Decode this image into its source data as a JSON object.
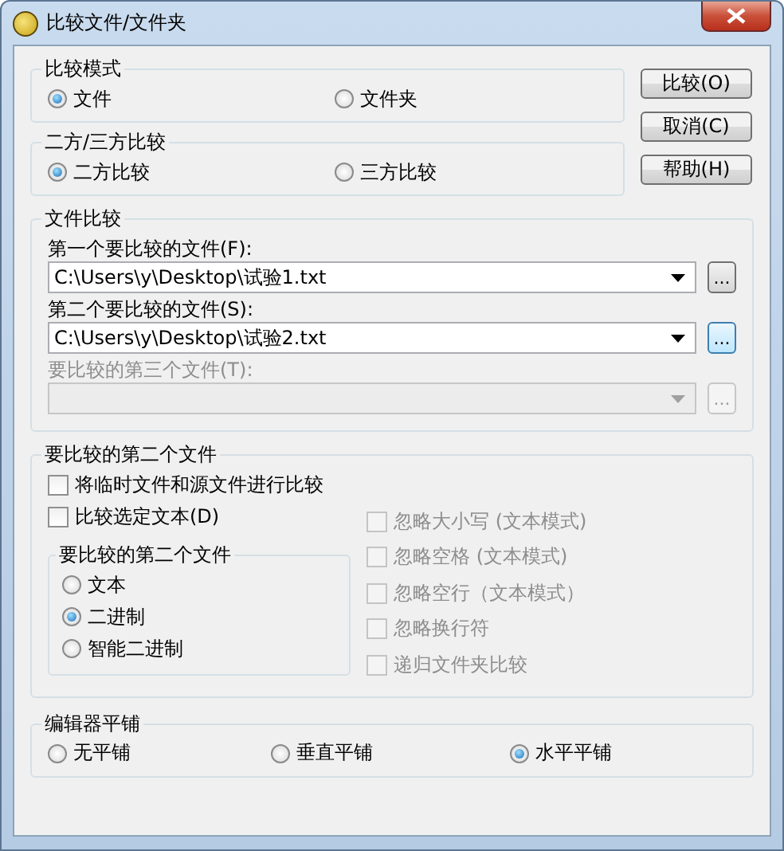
{
  "window": {
    "title": "比较文件/文件夹"
  },
  "compare_mode": {
    "label": "比较模式",
    "options": [
      {
        "label": "文件",
        "selected": true
      },
      {
        "label": "文件夹",
        "selected": false
      }
    ]
  },
  "way_mode": {
    "label": "二方/三方比较",
    "options": [
      {
        "label": "二方比较",
        "selected": true
      },
      {
        "label": "三方比较",
        "selected": false
      }
    ]
  },
  "buttons": [
    {
      "label": "比较(O)"
    },
    {
      "label": "取消(C)"
    },
    {
      "label": "帮助(H)"
    }
  ],
  "file_compare": {
    "label": "文件比较",
    "files": [
      {
        "label": "第一个要比较的文件(F):",
        "value": "C:\\Users\\y\\Desktop\\试验1.txt",
        "browse": "...",
        "disabled": false
      },
      {
        "label": "第二个要比较的文件(S):",
        "value": "C:\\Users\\y\\Desktop\\试验2.txt",
        "browse": "...",
        "disabled": false
      },
      {
        "label": "要比较的第三个文件(T):",
        "browse": "...",
        "disabled": true
      }
    ]
  },
  "second_file": {
    "label": "要比较的第二个文件",
    "checkboxes": [
      {
        "label": "将临时文件和源文件进行比较",
        "checked": false,
        "disabled": false
      },
      {
        "label": "比较选定文本(D)",
        "checked": false,
        "disabled": false
      }
    ],
    "type_group": {
      "label": "要比较的第二个文件",
      "options": [
        {
          "label": "文本",
          "selected": false
        },
        {
          "label": "二进制",
          "selected": true
        },
        {
          "label": "智能二进制",
          "selected": false
        }
      ]
    },
    "ignore_options": [
      {
        "label": "忽略大小写 (文本模式)",
        "checked": false,
        "disabled": true
      },
      {
        "label": "忽略空格 (文本模式)",
        "checked": false,
        "disabled": true
      },
      {
        "label": "忽略空行（文本模式）",
        "checked": false,
        "disabled": true
      },
      {
        "label": "忽略换行符",
        "checked": false,
        "disabled": true
      },
      {
        "label": "递归文件夹比较",
        "checked": false,
        "disabled": true
      }
    ]
  },
  "tiling": {
    "label": "编辑器平铺",
    "options": [
      {
        "label": "无平铺",
        "selected": false
      },
      {
        "label": "垂直平铺",
        "selected": false
      },
      {
        "label": "水平平铺",
        "selected": true
      }
    ]
  }
}
